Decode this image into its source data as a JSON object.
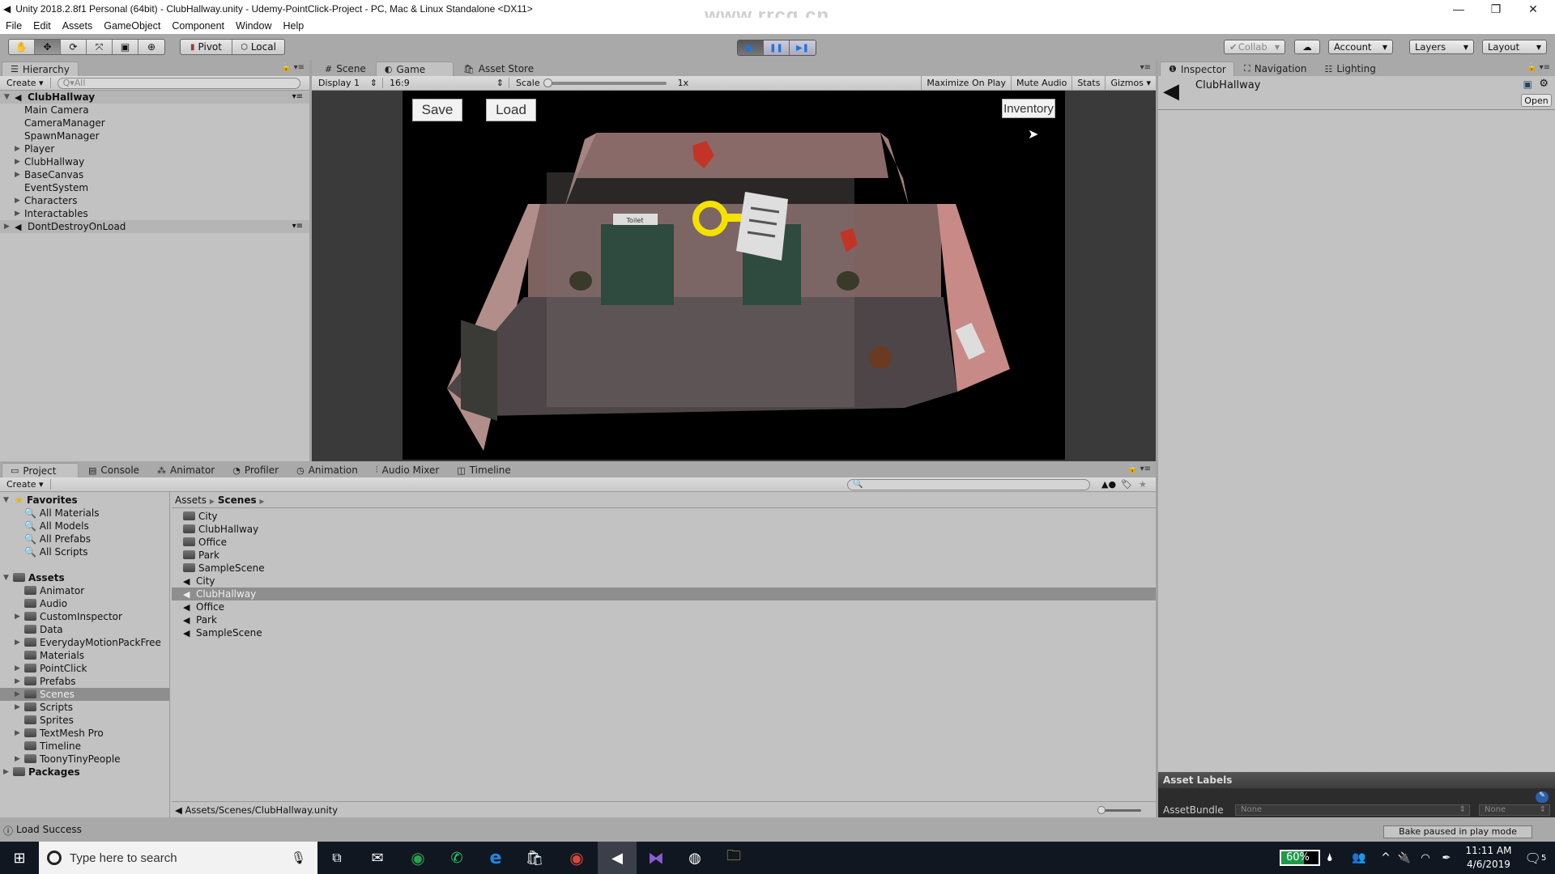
{
  "window": {
    "title": "Unity 2018.2.8f1 Personal (64bit) - ClubHallway.unity - Udemy-PointClick-Project - PC, Mac & Linux Standalone <DX11>",
    "controls": {
      "minimize": "—",
      "restore": "❐",
      "close": "✕"
    }
  },
  "menu": [
    "File",
    "Edit",
    "Assets",
    "GameObject",
    "Component",
    "Window",
    "Help"
  ],
  "toolbar": {
    "tools": [
      {
        "name": "hand-tool",
        "glyph": "✋"
      },
      {
        "name": "move-tool",
        "glyph": "✥",
        "active": true
      },
      {
        "name": "rotate-tool",
        "glyph": "⟳"
      },
      {
        "name": "scale-tool",
        "glyph": "⤧"
      },
      {
        "name": "rect-tool",
        "glyph": "▣"
      },
      {
        "name": "transform-tool",
        "glyph": "⊕"
      }
    ],
    "pivot_label": "Pivot",
    "local_label": "Local",
    "play_controls": {
      "play": "▶",
      "pause": "❚❚",
      "step": "▶❚"
    },
    "collab_label": "Collab",
    "cloud_glyph": "☁",
    "account_label": "Account",
    "layers_label": "Layers",
    "layout_label": "Layout"
  },
  "hierarchy": {
    "tab_label": "Hierarchy",
    "create_label": "Create",
    "search_placeholder": "All",
    "scene_name": "ClubHallway",
    "items": [
      {
        "label": "Main Camera",
        "expandable": false
      },
      {
        "label": "CameraManager",
        "expandable": false
      },
      {
        "label": "SpawnManager",
        "expandable": false
      },
      {
        "label": "Player",
        "expandable": true
      },
      {
        "label": "ClubHallway",
        "expandable": true
      },
      {
        "label": "BaseCanvas",
        "expandable": true
      },
      {
        "label": "EventSystem",
        "expandable": false
      },
      {
        "label": "Characters",
        "expandable": true
      },
      {
        "label": "Interactables",
        "expandable": true
      }
    ],
    "dont_destroy": "DontDestroyOnLoad"
  },
  "center_tabs": [
    {
      "label": "Scene",
      "icon": "#"
    },
    {
      "label": "Game",
      "icon": "◐",
      "active": true
    },
    {
      "label": "Asset Store",
      "icon": "🛍"
    }
  ],
  "game_bar": {
    "display": "Display 1",
    "aspect": "16:9",
    "scale_label": "Scale",
    "scale_value": "1x",
    "maximize_on_play": "Maximize On Play",
    "mute_audio": "Mute Audio",
    "stats": "Stats",
    "gizmos": "Gizmos"
  },
  "game_ui": {
    "save_label": "Save",
    "load_label": "Load",
    "inventory_label": "Inventory",
    "toilet_sign": "Toilet"
  },
  "inspector": {
    "tabs": [
      {
        "label": "Inspector",
        "icon": "❶",
        "active": true
      },
      {
        "label": "Navigation",
        "icon": "⛶"
      },
      {
        "label": "Lighting",
        "icon": "☷"
      }
    ],
    "object_name": "ClubHallway",
    "open_label": "Open",
    "asset_labels_title": "Asset Labels",
    "assetbundle_label": "AssetBundle",
    "assetbundle_value": "None",
    "assetbundle_variant": "None",
    "bake_status": "Bake paused in play mode"
  },
  "bottom_tabs": [
    {
      "label": "Project",
      "icon": "▭",
      "active": true
    },
    {
      "label": "Console",
      "icon": "▤"
    },
    {
      "label": "Animator",
      "icon": "⁂"
    },
    {
      "label": "Profiler",
      "icon": "◔"
    },
    {
      "label": "Animation",
      "icon": "◷"
    },
    {
      "label": "Audio Mixer",
      "icon": "⫶"
    },
    {
      "label": "Timeline",
      "icon": "◫"
    }
  ],
  "project": {
    "create_label": "Create",
    "favorites_label": "Favorites",
    "favorites": [
      "All Materials",
      "All Models",
      "All Prefabs",
      "All Scripts"
    ],
    "assets_label": "Assets",
    "asset_folders": [
      {
        "label": "Animator",
        "expandable": false
      },
      {
        "label": "Audio",
        "expandable": false
      },
      {
        "label": "CustomInspector",
        "expandable": true
      },
      {
        "label": "Data",
        "expandable": false
      },
      {
        "label": "EverydayMotionPackFree",
        "expandable": true
      },
      {
        "label": "Materials",
        "expandable": false
      },
      {
        "label": "PointClick",
        "expandable": true
      },
      {
        "label": "Prefabs",
        "expandable": true
      },
      {
        "label": "Scenes",
        "expandable": true,
        "selected": true
      },
      {
        "label": "Scripts",
        "expandable": true
      },
      {
        "label": "Sprites",
        "expandable": false
      },
      {
        "label": "TextMesh Pro",
        "expandable": true
      },
      {
        "label": "Timeline",
        "expandable": false
      },
      {
        "label": "ToonyTinyPeople",
        "expandable": true
      }
    ],
    "packages_label": "Packages",
    "breadcrumb": [
      "Assets",
      "Scenes"
    ],
    "files": [
      {
        "label": "City",
        "type": "folder"
      },
      {
        "label": "ClubHallway",
        "type": "folder"
      },
      {
        "label": "Office",
        "type": "folder"
      },
      {
        "label": "Park",
        "type": "folder"
      },
      {
        "label": "SampleScene",
        "type": "folder"
      },
      {
        "label": "City",
        "type": "scene"
      },
      {
        "label": "ClubHallway",
        "type": "scene",
        "selected": true
      },
      {
        "label": "Office",
        "type": "scene"
      },
      {
        "label": "Park",
        "type": "scene"
      },
      {
        "label": "SampleScene",
        "type": "scene"
      }
    ],
    "selected_path": "Assets/Scenes/ClubHallway.unity"
  },
  "status": {
    "message": "Load Success"
  },
  "taskbar": {
    "search_placeholder": "Type here to search",
    "battery": "60%",
    "battery_level": 0.6,
    "time": "11:11 AM",
    "date": "4/6/2019",
    "notifications": "5"
  },
  "watermark": "www.rrcg.cn"
}
